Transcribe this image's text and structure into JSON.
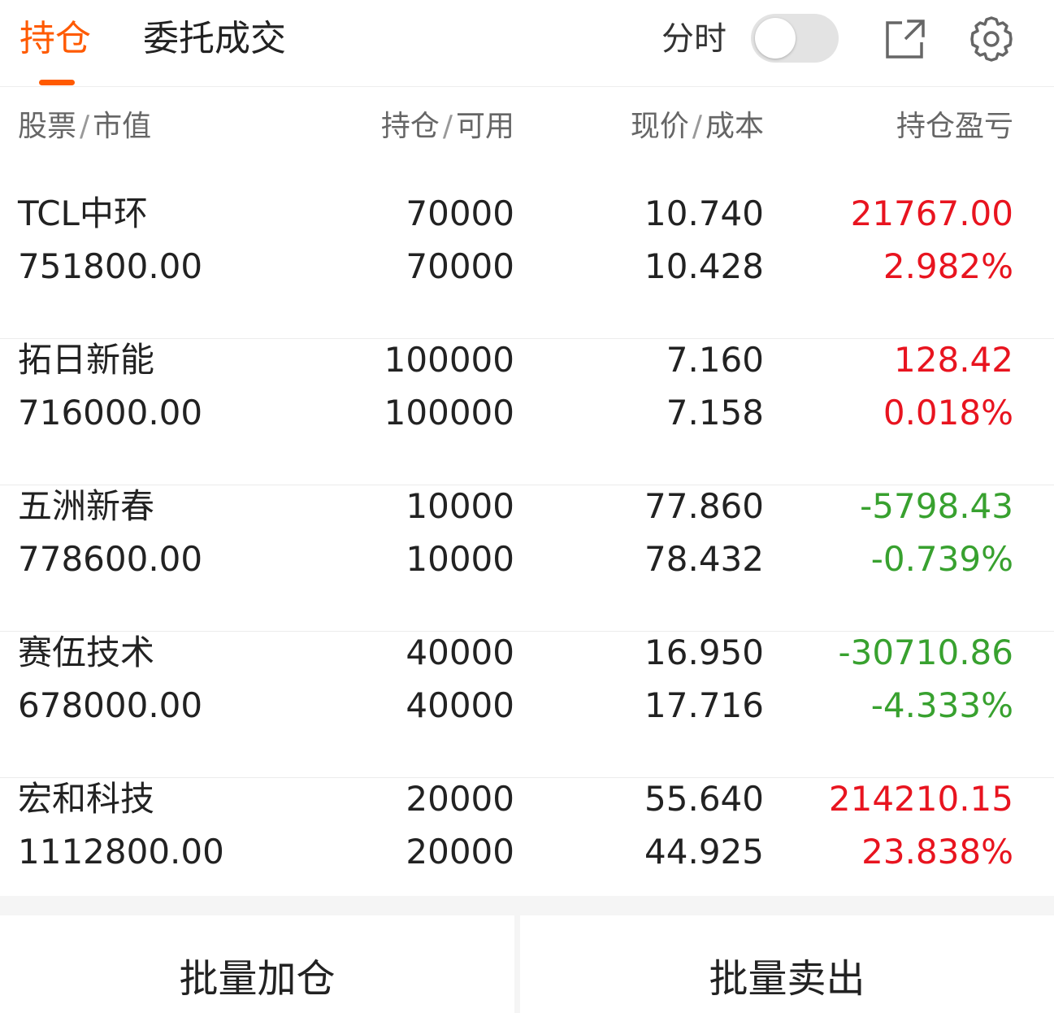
{
  "tabs": {
    "positions": "持仓",
    "orders": "委托成交"
  },
  "header_controls": {
    "timeshare_label": "分时",
    "timeshare_on": false
  },
  "columns": {
    "stock": "股票",
    "market_value": "市值",
    "holdings": "持仓",
    "available": "可用",
    "price": "现价",
    "cost": "成本",
    "profit_loss": "持仓盈亏"
  },
  "columns_sep": "/",
  "positions": [
    {
      "name": "TCL中环",
      "market_value": "751800.00",
      "holdings": "70000",
      "available": "70000",
      "price": "10.740",
      "cost": "10.428",
      "pl": "21767.00",
      "pl_pct": "2.982%",
      "trend": "up"
    },
    {
      "name": "拓日新能",
      "market_value": "716000.00",
      "holdings": "100000",
      "available": "100000",
      "price": "7.160",
      "cost": "7.158",
      "pl": "128.42",
      "pl_pct": "0.018%",
      "trend": "up"
    },
    {
      "name": "五洲新春",
      "market_value": "778600.00",
      "holdings": "10000",
      "available": "10000",
      "price": "77.860",
      "cost": "78.432",
      "pl": "-5798.43",
      "pl_pct": "-0.739%",
      "trend": "down"
    },
    {
      "name": "赛伍技术",
      "market_value": "678000.00",
      "holdings": "40000",
      "available": "40000",
      "price": "16.950",
      "cost": "17.716",
      "pl": "-30710.86",
      "pl_pct": "-4.333%",
      "trend": "down"
    },
    {
      "name": "宏和科技",
      "market_value": "1112800.00",
      "holdings": "20000",
      "available": "20000",
      "price": "55.640",
      "cost": "44.925",
      "pl": "214210.15",
      "pl_pct": "23.838%",
      "trend": "up"
    }
  ],
  "actions": {
    "batch_add": "批量加仓",
    "batch_sell": "批量卖出"
  },
  "colors": {
    "accent": "#ff5a00",
    "up": "#e8141f",
    "down": "#38a12f"
  },
  "icons": [
    "share-icon",
    "settings-gear-icon"
  ]
}
